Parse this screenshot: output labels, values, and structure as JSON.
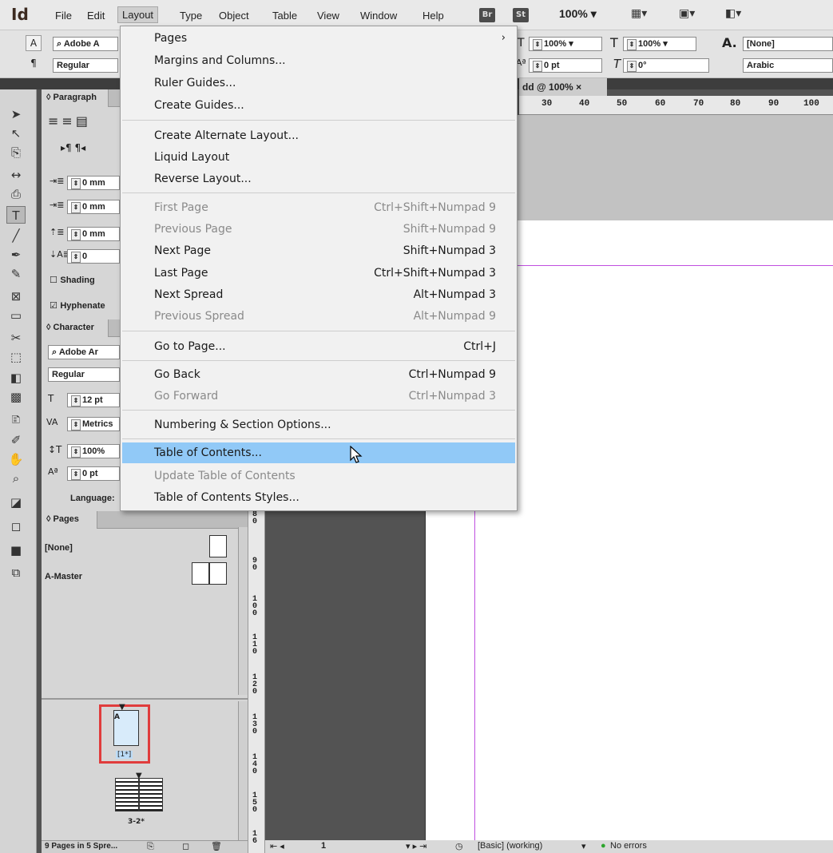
{
  "app": {
    "logo": "Id"
  },
  "menubar": {
    "items": [
      "File",
      "Edit",
      "Layout",
      "Type",
      "Object",
      "Table",
      "View",
      "Window",
      "Help"
    ],
    "active": "Layout",
    "badges": [
      "Br",
      "St"
    ],
    "zoom": "100%"
  },
  "control": {
    "font_search": "Adobe A",
    "font_style": "Regular",
    "scale_v": "100%",
    "scale_h": "100%",
    "baseline": "0 pt",
    "skew": "0°",
    "char_style": "[None]",
    "language": "Arabic"
  },
  "document": {
    "tab": "dd @ 100%",
    "close": "×"
  },
  "hruler": [
    "30",
    "40",
    "50",
    "60",
    "70",
    "80",
    "90",
    "100"
  ],
  "vruler": [
    "8\n0",
    "9\n0",
    "1\n0\n0",
    "1\n1\n0",
    "1\n2\n0",
    "1\n3\n0",
    "1\n4\n0",
    "1\n5\n0",
    "1\n6"
  ],
  "paragraph_panel": {
    "title": "Paragraph",
    "indent_left": "0 mm",
    "indent_first": "0 mm",
    "space_before": "0 mm",
    "drop_cap": "0",
    "shading": "Shading",
    "hyphenate": "Hyphenate"
  },
  "character_panel": {
    "title": "Character",
    "font": "Adobe Ar",
    "style": "Regular",
    "size": "12 pt",
    "kerning": "Metrics",
    "leading": "100%",
    "baseline": "0 pt",
    "language_label": "Language:"
  },
  "pages_panel": {
    "title": "Pages",
    "none": "[None]",
    "master": "A-Master",
    "page1_prefix": "A",
    "page1_label": "[1*]",
    "spread_label": "3-2*",
    "status": "9 Pages in 5 Spre..."
  },
  "statusbar": {
    "page": "1",
    "preflight_profile": "[Basic] (working)",
    "errors": "No errors"
  },
  "layout_menu": {
    "items": [
      {
        "label": "Pages",
        "shortcut": "",
        "submenu": true,
        "disabled": false
      },
      {
        "label": "Margins and Columns...",
        "shortcut": "",
        "disabled": false
      },
      {
        "label": "Ruler Guides...",
        "shortcut": "",
        "disabled": false
      },
      {
        "label": "Create Guides...",
        "shortcut": "",
        "disabled": false
      },
      {
        "label": "Create Alternate Layout...",
        "shortcut": "",
        "disabled": false
      },
      {
        "label": "Liquid Layout",
        "shortcut": "",
        "disabled": false
      },
      {
        "label": "Reverse Layout...",
        "shortcut": "",
        "disabled": false
      },
      {
        "label": "First Page",
        "shortcut": "Ctrl+Shift+Numpad 9",
        "disabled": true
      },
      {
        "label": "Previous Page",
        "shortcut": "Shift+Numpad 9",
        "disabled": true
      },
      {
        "label": "Next Page",
        "shortcut": "Shift+Numpad 3",
        "disabled": false
      },
      {
        "label": "Last Page",
        "shortcut": "Ctrl+Shift+Numpad 3",
        "disabled": false
      },
      {
        "label": "Next Spread",
        "shortcut": "Alt+Numpad 3",
        "disabled": false
      },
      {
        "label": "Previous Spread",
        "shortcut": "Alt+Numpad 9",
        "disabled": true
      },
      {
        "label": "Go to Page...",
        "shortcut": "Ctrl+J",
        "disabled": false
      },
      {
        "label": "Go Back",
        "shortcut": "Ctrl+Numpad 9",
        "disabled": false
      },
      {
        "label": "Go Forward",
        "shortcut": "Ctrl+Numpad 3",
        "disabled": true
      },
      {
        "label": "Numbering & Section Options...",
        "shortcut": "",
        "disabled": false
      },
      {
        "label": "Table of Contents...",
        "shortcut": "",
        "disabled": false,
        "highlighted": true
      },
      {
        "label": "Update Table of Contents",
        "shortcut": "",
        "disabled": true
      },
      {
        "label": "Table of Contents Styles...",
        "shortcut": "",
        "disabled": false
      }
    ]
  },
  "colors": {
    "highlight": "#91c9f7",
    "margin_guide": "#c050e0",
    "selection_box": "#e03c3c"
  }
}
